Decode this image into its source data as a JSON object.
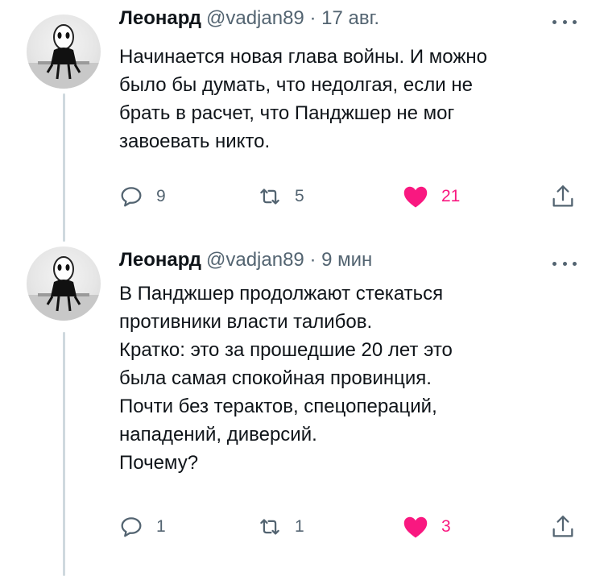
{
  "tweets": [
    {
      "author_name": "Леонард",
      "handle_date": "@vadjan89 · 17 авг.",
      "text": "Начинается новая глава войны. И можно\nбыло бы думать, что недолгая, если не\nбрать в расчет, что Панджшер не мог\nзавоевать никто.",
      "replies": "9",
      "retweets": "5",
      "likes": "21"
    },
    {
      "author_name": "Леонард",
      "handle_date": "@vadjan89 · 9 мин",
      "text": "В Панджшер продолжают стекаться\nпротивники власти талибов.\nКратко: это за прошедшие 20 лет это\nбыла самая спокойная провинция.\nПочти без терактов, спецопераций,\nнападений, диверсий.\nПочему?",
      "replies": "1",
      "retweets": "1",
      "likes": "3"
    }
  ],
  "colors": {
    "text": "#0f1419",
    "secondary": "#536471",
    "like": "#f91880",
    "thread_line": "#cfd9de"
  },
  "icons": [
    "avatar-figure",
    "more-icon",
    "reply-icon",
    "retweet-icon",
    "heart-icon",
    "share-icon"
  ]
}
